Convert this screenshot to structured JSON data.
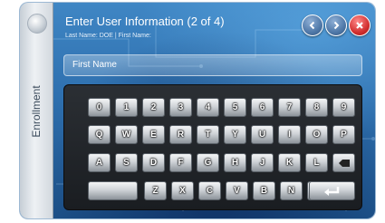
{
  "dialog": {
    "title": "Enter User Information (2 of 4)",
    "subtitle": "Last Name: DOE | First Name:",
    "side_tab_label": "Enrollment"
  },
  "nav": {
    "back_icon": "chevron-left-icon",
    "forward_icon": "chevron-right-icon",
    "close_icon": "close-icon"
  },
  "field": {
    "label": "First Name",
    "value": ""
  },
  "keyboard": {
    "row1": [
      "0",
      "1",
      "2",
      "3",
      "4",
      "5",
      "6",
      "7",
      "8",
      "9"
    ],
    "row2": [
      "Q",
      "W",
      "E",
      "R",
      "T",
      "Y",
      "U",
      "I",
      "O",
      "P"
    ],
    "row3": [
      "A",
      "S",
      "D",
      "F",
      "G",
      "H",
      "J",
      "K",
      "L"
    ],
    "row4": [
      "Z",
      "X",
      "C",
      "V",
      "B",
      "N",
      "M"
    ],
    "backspace_icon": "backspace-icon",
    "enter_icon": "enter-icon"
  },
  "colors": {
    "background_blue": "#2e6fae",
    "keyboard_dark": "#1a1d21",
    "close_red": "#d23030"
  }
}
